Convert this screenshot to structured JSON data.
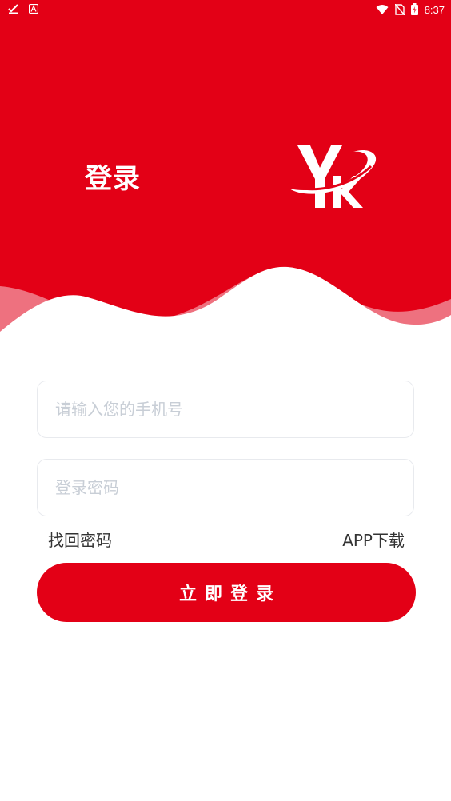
{
  "status_bar": {
    "time": "8:37",
    "left_icons": [
      "checkmark-download-icon",
      "font-a-icon"
    ],
    "right_icons": [
      "wifi-icon",
      "no-sim-icon",
      "battery-charging-icon"
    ]
  },
  "header": {
    "title": "登录",
    "logo_icon": "yk-logo-icon",
    "background_color": "#e30016"
  },
  "form": {
    "phone_placeholder": "请输入您的手机号",
    "phone_value": "",
    "password_placeholder": "登录密码",
    "password_value": "",
    "forgot_password_label": "找回密码",
    "app_download_label": "APP下载",
    "submit_label": "立即登录"
  }
}
